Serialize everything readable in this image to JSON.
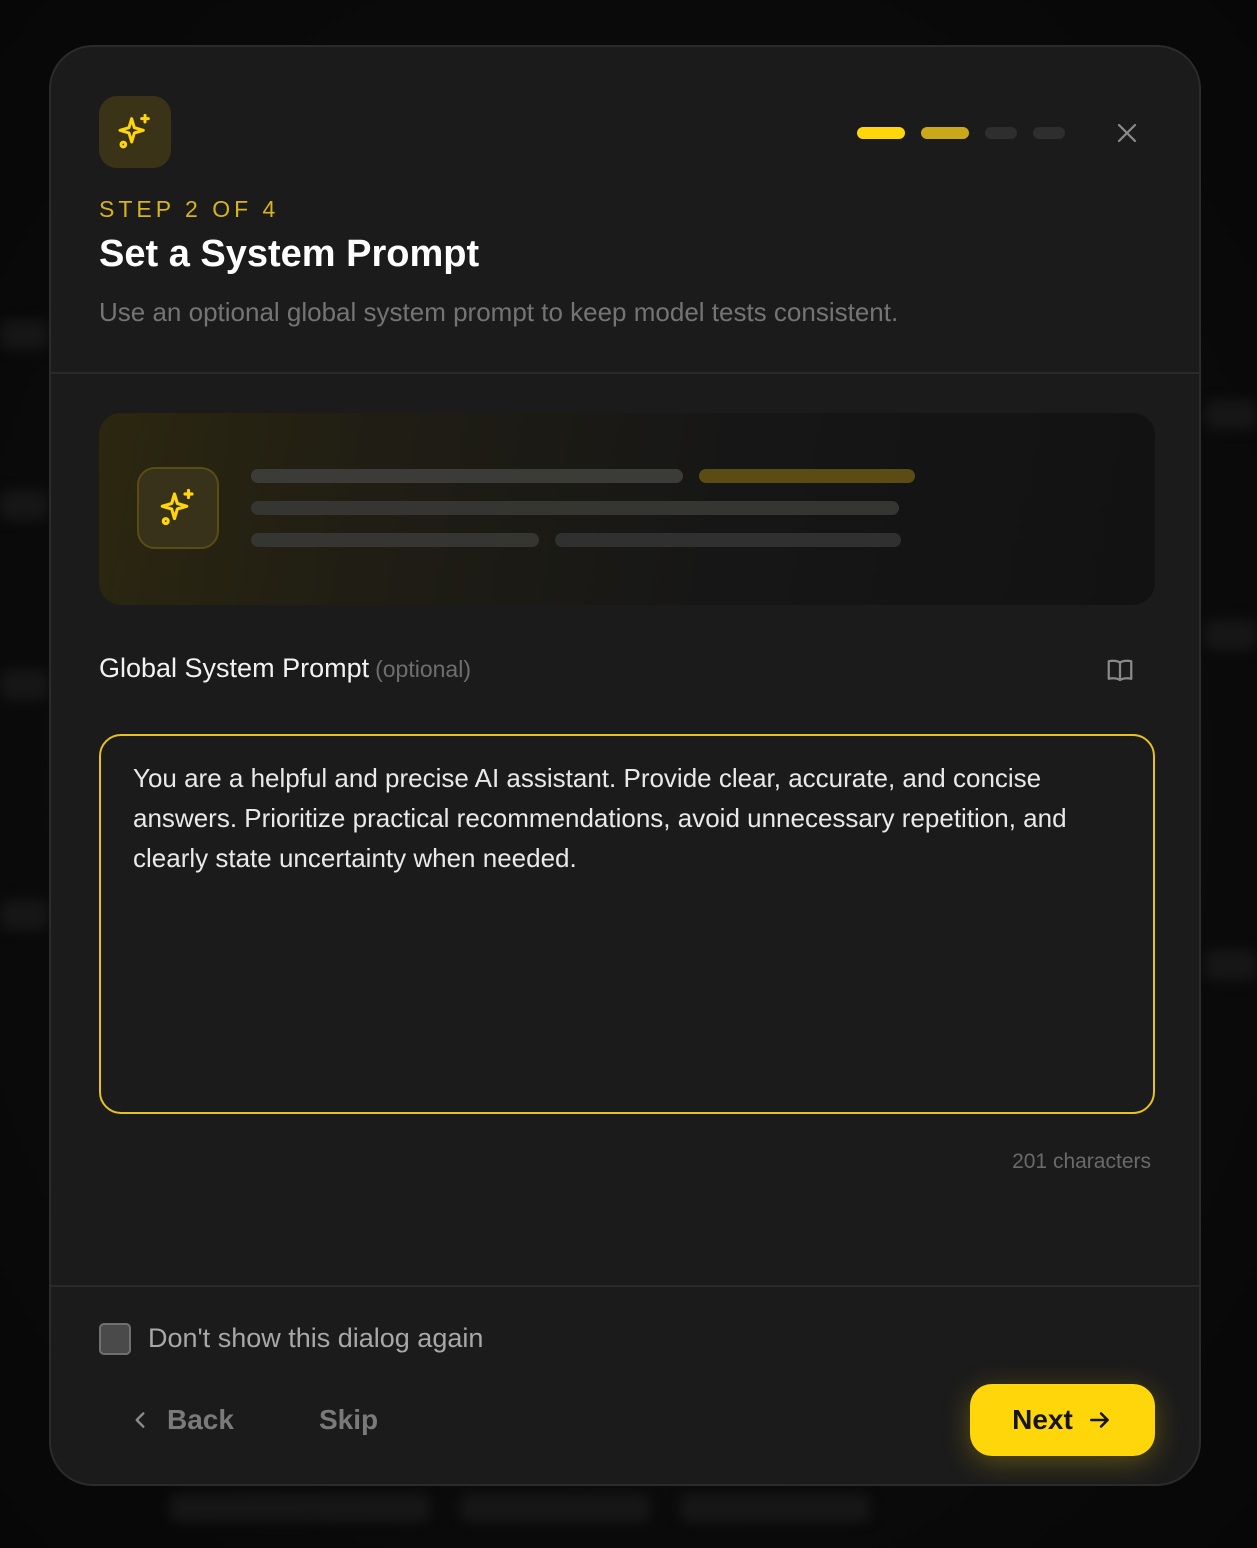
{
  "dialog": {
    "step_label": "STEP 2 OF 4",
    "title": "Set a System Prompt",
    "subtitle": "Use an optional global system prompt to keep model tests consistent.",
    "progress": {
      "current_step": 2,
      "total_steps": 4
    }
  },
  "field": {
    "label": "Global System Prompt",
    "optional_label": "(optional)",
    "value": "You are a helpful and precise AI assistant. Provide clear, accurate, and concise answers. Prioritize practical recommendations, avoid unnecessary repetition, and clearly state uncertainty when needed.",
    "char_count": "201 characters"
  },
  "footer": {
    "checkbox_label": "Don't show this dialog again",
    "checkbox_checked": false,
    "back_label": "Back",
    "skip_label": "Skip",
    "next_label": "Next"
  },
  "icons": {
    "header": "sparkles-icon",
    "preview": "sparkles-icon",
    "close": "close-icon",
    "book": "book-icon",
    "back": "chevron-left-icon",
    "next": "arrow-right-icon"
  },
  "colors": {
    "accent": "#ffd60a",
    "accent_dim": "#c9a81a",
    "step_label": "#d8b41c",
    "background": "#1b1b1b"
  }
}
